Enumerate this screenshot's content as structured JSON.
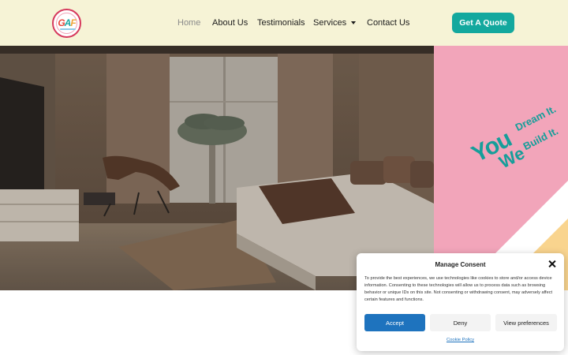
{
  "header": {
    "logo": {
      "text_g": "G",
      "text_a": "A",
      "text_f": "F"
    },
    "nav": {
      "home": "Home",
      "about": "About Us",
      "testimonials": "Testimonials",
      "services": "Services",
      "contact": "Contact Us"
    },
    "cta_label": "Get A Quote"
  },
  "hero": {
    "slogan": {
      "you": "You",
      "dream": "Dream It.",
      "we": "We",
      "build": "Build It."
    }
  },
  "consent": {
    "title": "Manage Consent",
    "body": "To provide the best experiences, we use technologies like cookies to store and/or access device information. Consenting to these technologies will allow us to process data such as browsing behavior or unique IDs on this site. Not consenting or withdrawing consent, may adversely affect certain features and functions.",
    "accept_label": "Accept",
    "deny_label": "Deny",
    "preferences_label": "View preferences",
    "policy_link": "Cookie Policy"
  },
  "colors": {
    "header_bg": "#f6f3d6",
    "accent_teal": "#13a89e",
    "pink_panel": "#f2a5ba",
    "accept_blue": "#1e73be"
  }
}
